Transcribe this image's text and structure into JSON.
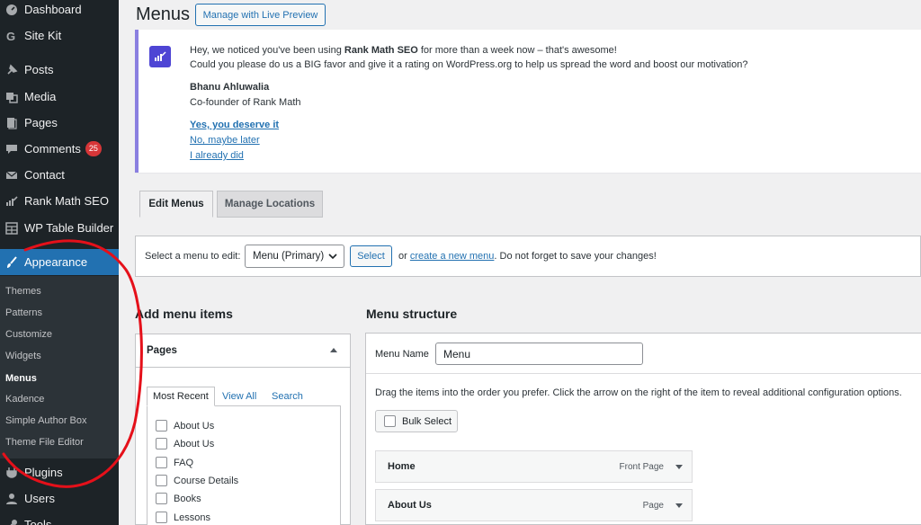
{
  "sidebar": {
    "items": [
      {
        "label": "Dashboard",
        "icon": "dashboard-icon"
      },
      {
        "label": "Site Kit",
        "icon": "site-kit-icon"
      },
      {
        "label": "Posts",
        "icon": "pin-icon"
      },
      {
        "label": "Media",
        "icon": "media-icon"
      },
      {
        "label": "Pages",
        "icon": "pages-icon"
      },
      {
        "label": "Comments",
        "icon": "comment-icon",
        "badge": "25"
      },
      {
        "label": "Contact",
        "icon": "mail-icon"
      },
      {
        "label": "Rank Math SEO",
        "icon": "rank-math-icon"
      },
      {
        "label": "WP Table Builder",
        "icon": "table-icon"
      },
      {
        "label": "Appearance",
        "icon": "paintbrush-icon"
      },
      {
        "label": "Plugins",
        "icon": "plugin-icon"
      },
      {
        "label": "Users",
        "icon": "user-icon"
      },
      {
        "label": "Tools",
        "icon": "wrench-icon"
      }
    ],
    "submenu": [
      "Themes",
      "Patterns",
      "Customize",
      "Widgets",
      "Menus",
      "Kadence",
      "Simple Author Box",
      "Theme File Editor"
    ]
  },
  "header": {
    "title": "Menus",
    "live_preview_label": "Manage with Live Preview"
  },
  "notice": {
    "line1_pre": "Hey, we noticed you've been using ",
    "line1_bold": "Rank Math SEO",
    "line1_post": " for more than a week now – that's awesome!",
    "line2": "Could you please do us a BIG favor and give it a rating on WordPress.org to help us spread the word and boost our motivation?",
    "author": "Bhanu Ahluwalia",
    "role": "Co-founder of Rank Math",
    "link_yes": "Yes, you deserve it",
    "link_no": "No, maybe later",
    "link_did": "I already did"
  },
  "tabs": {
    "edit": "Edit Menus",
    "manage": "Manage Locations"
  },
  "select_bar": {
    "label": "Select a menu to edit:",
    "selected": "Menu (Primary)",
    "select_button": "Select",
    "or_text": "or",
    "create_link": "create a new menu",
    "post_text": ". Do not forget to save your changes!"
  },
  "add_items": {
    "heading": "Add menu items",
    "box_title": "Pages",
    "tabs": [
      "Most Recent",
      "View All",
      "Search"
    ],
    "pages": [
      "About Us",
      "About Us",
      "FAQ",
      "Course Details",
      "Books",
      "Lessons"
    ]
  },
  "structure": {
    "heading": "Menu structure",
    "name_label": "Menu Name",
    "name_value": "Menu",
    "instructions": "Drag the items into the order you prefer. Click the arrow on the right of the item to reveal additional configuration options.",
    "bulk_select": "Bulk Select",
    "entries": [
      {
        "title": "Home",
        "type": "Front Page"
      },
      {
        "title": "About Us",
        "type": "Page"
      }
    ]
  },
  "colors": {
    "accent": "#2271b1",
    "sidebar": "#1d2327",
    "highlight": "#e5101a"
  }
}
